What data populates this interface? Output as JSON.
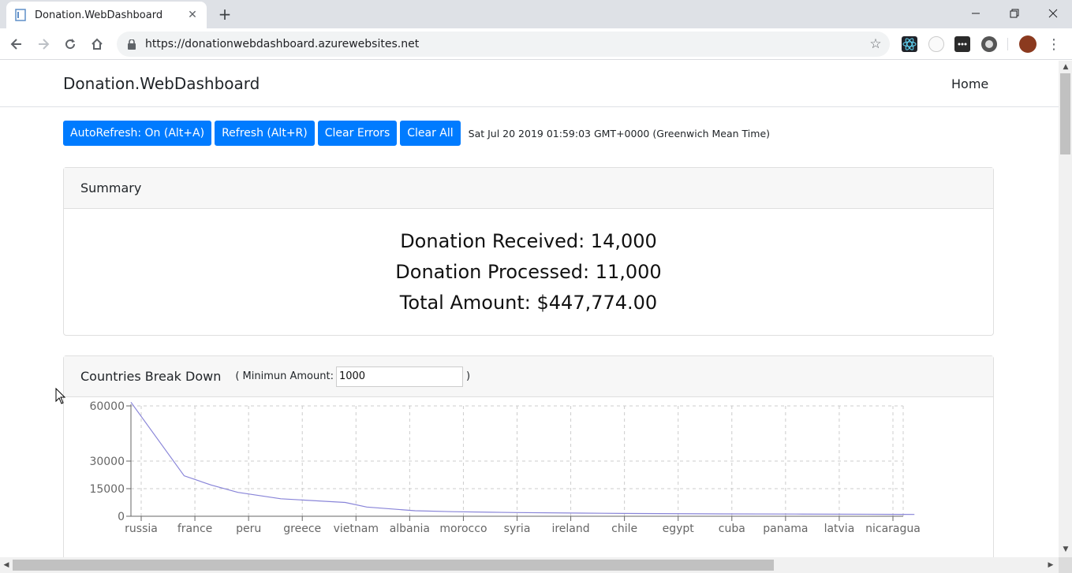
{
  "browser": {
    "tab_title": "Donation.WebDashboard",
    "url": "https://donationwebdashboard.azurewebsites.net",
    "icons": [
      "back-icon",
      "forward-icon",
      "reload-icon",
      "home-icon",
      "lock-icon",
      "star-icon",
      "menu-icon"
    ]
  },
  "navbar": {
    "brand": "Donation.WebDashboard",
    "home": "Home"
  },
  "toolbar": {
    "autorefresh_label": "AutoRefresh: On (Alt+A)",
    "refresh_label": "Refresh (Alt+R)",
    "clear_errors_label": "Clear Errors",
    "clear_all_label": "Clear All",
    "timestamp": "Sat Jul 20 2019 01:59:03 GMT+0000 (Greenwich Mean Time)"
  },
  "summary": {
    "title": "Summary",
    "received": "Donation Received: 14,000",
    "processed": "Donation Processed: 11,000",
    "total": "Total Amount: $447,774.00"
  },
  "countries": {
    "title": "Countries Break Down",
    "filter_label": "( Minimun Amount:",
    "filter_value": "1000",
    "filter_close": ")"
  },
  "colors": {
    "primary": "#007bff",
    "line": "#8884d8"
  },
  "chart_data": {
    "type": "line",
    "categories": [
      "russia",
      "france",
      "peru",
      "greece",
      "vietnam",
      "albania",
      "morocco",
      "syria",
      "ireland",
      "chile",
      "egypt",
      "cuba",
      "panama",
      "latvia",
      "nicaragua"
    ],
    "yticks": [
      0,
      15000,
      30000,
      60000
    ],
    "ylim": [
      0,
      60000
    ],
    "grid": true,
    "x": [
      0,
      0.8,
      1.3,
      1.8,
      2.6,
      3.8,
      4.2,
      5.1,
      5.8,
      6.5,
      7.0,
      8.2,
      9.2,
      10.8,
      12.2,
      13.5,
      14.4
    ],
    "values": [
      62000,
      22000,
      17000,
      13000,
      9500,
      7500,
      5000,
      3000,
      2500,
      2200,
      2000,
      1700,
      1500,
      1300,
      1200,
      1100,
      1000
    ]
  }
}
